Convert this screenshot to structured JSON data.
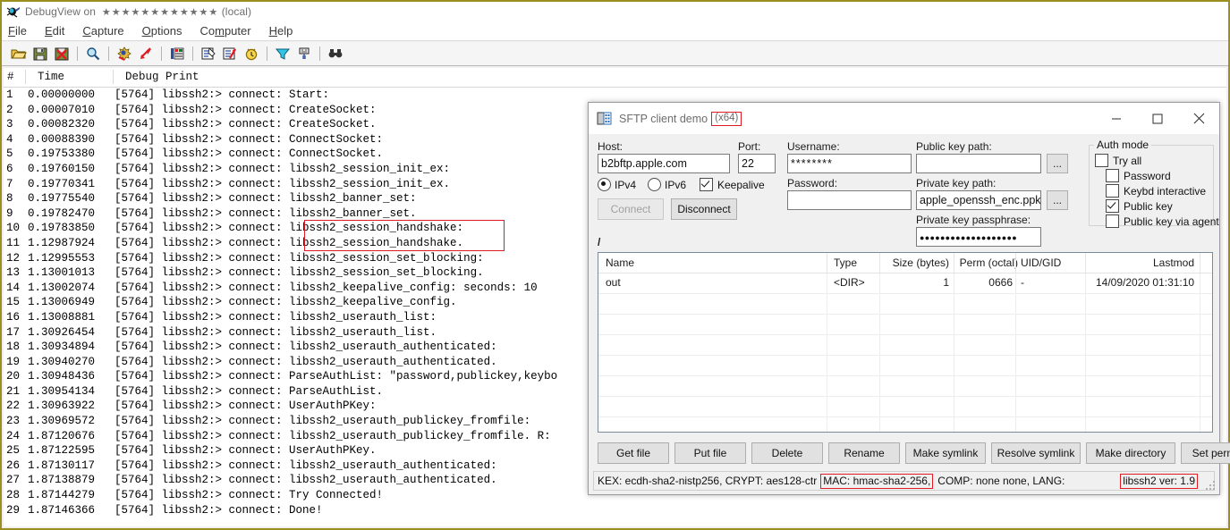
{
  "debugview": {
    "title_prefix": "DebugView on",
    "title_masked": "★★★★★★★★★★★★",
    "title_suffix": "(local)",
    "icon": "bug-icon",
    "menu": [
      {
        "name": "file",
        "pre": "",
        "accel": "F",
        "post": "ile"
      },
      {
        "name": "edit",
        "pre": "",
        "accel": "E",
        "post": "dit"
      },
      {
        "name": "capture",
        "pre": "",
        "accel": "C",
        "post": "apture"
      },
      {
        "name": "options",
        "pre": "",
        "accel": "O",
        "post": "ptions"
      },
      {
        "name": "computer",
        "pre": "Co",
        "accel": "m",
        "post": "puter"
      },
      {
        "name": "help",
        "pre": "",
        "accel": "H",
        "post": "elp"
      }
    ],
    "toolbar": [
      {
        "name": "open-icon",
        "kind": "icon"
      },
      {
        "name": "save-icon",
        "kind": "icon"
      },
      {
        "name": "clear-icon",
        "kind": "icon"
      },
      {
        "name": "separator",
        "kind": "sep"
      },
      {
        "name": "find-icon",
        "kind": "icon"
      },
      {
        "name": "separator",
        "kind": "sep"
      },
      {
        "name": "capture-win32-icon",
        "kind": "icon"
      },
      {
        "name": "capture-kernel-icon",
        "kind": "icon"
      },
      {
        "name": "separator",
        "kind": "sep"
      },
      {
        "name": "capture-events-icon",
        "kind": "icon"
      },
      {
        "name": "separator",
        "kind": "sep"
      },
      {
        "name": "autoscroll-icon",
        "kind": "icon"
      },
      {
        "name": "clear-display-icon",
        "kind": "icon"
      },
      {
        "name": "clock-icon",
        "kind": "icon"
      },
      {
        "name": "separator",
        "kind": "sep"
      },
      {
        "name": "filter-icon",
        "kind": "icon"
      },
      {
        "name": "highlight-icon",
        "kind": "icon"
      },
      {
        "name": "separator",
        "kind": "sep"
      },
      {
        "name": "find-next-icon",
        "kind": "icon"
      }
    ],
    "columns": [
      "#",
      "Time",
      "Debug Print"
    ],
    "rows": [
      {
        "n": "1",
        "t": "0.00000000",
        "m": "[5764] libssh2:> connect: Start:"
      },
      {
        "n": "2",
        "t": "0.00007010",
        "m": "[5764] libssh2:> connect: CreateSocket:"
      },
      {
        "n": "3",
        "t": "0.00082320",
        "m": "[5764] libssh2:> connect: CreateSocket."
      },
      {
        "n": "4",
        "t": "0.00088390",
        "m": "[5764] libssh2:> connect: ConnectSocket:"
      },
      {
        "n": "5",
        "t": "0.19753380",
        "m": "[5764] libssh2:> connect: ConnectSocket."
      },
      {
        "n": "6",
        "t": "0.19760150",
        "m": "[5764] libssh2:> connect: libssh2_session_init_ex:"
      },
      {
        "n": "7",
        "t": "0.19770341",
        "m": "[5764] libssh2:> connect: libssh2_session_init_ex."
      },
      {
        "n": "8",
        "t": "0.19775540",
        "m": "[5764] libssh2:> connect: libssh2_banner_set:"
      },
      {
        "n": "9",
        "t": "0.19782470",
        "m": "[5764] libssh2:> connect: libssh2_banner_set."
      },
      {
        "n": "10",
        "t": "0.19783850",
        "m": "[5764] libssh2:> connect: libssh2_session_handshake:"
      },
      {
        "n": "11",
        "t": "1.12987924",
        "m": "[5764] libssh2:> connect: libssh2_session_handshake."
      },
      {
        "n": "12",
        "t": "1.12995553",
        "m": "[5764] libssh2:> connect: libssh2_session_set_blocking:"
      },
      {
        "n": "13",
        "t": "1.13001013",
        "m": "[5764] libssh2:> connect: libssh2_session_set_blocking."
      },
      {
        "n": "14",
        "t": "1.13002074",
        "m": "[5764] libssh2:> connect: libssh2_keepalive_config: seconds: 10"
      },
      {
        "n": "15",
        "t": "1.13006949",
        "m": "[5764] libssh2:> connect: libssh2_keepalive_config."
      },
      {
        "n": "16",
        "t": "1.13008881",
        "m": "[5764] libssh2:> connect: libssh2_userauth_list:"
      },
      {
        "n": "17",
        "t": "1.30926454",
        "m": "[5764] libssh2:> connect: libssh2_userauth_list."
      },
      {
        "n": "18",
        "t": "1.30934894",
        "m": "[5764] libssh2:> connect: libssh2_userauth_authenticated:"
      },
      {
        "n": "19",
        "t": "1.30940270",
        "m": "[5764] libssh2:> connect: libssh2_userauth_authenticated."
      },
      {
        "n": "20",
        "t": "1.30948436",
        "m": "[5764] libssh2:> connect: ParseAuthList: \"password,publickey,keybo"
      },
      {
        "n": "21",
        "t": "1.30954134",
        "m": "[5764] libssh2:> connect: ParseAuthList."
      },
      {
        "n": "22",
        "t": "1.30963922",
        "m": "[5764] libssh2:> connect: UserAuthPKey:"
      },
      {
        "n": "23",
        "t": "1.30969572",
        "m": "[5764] libssh2:> connect: libssh2_userauth_publickey_fromfile:"
      },
      {
        "n": "24",
        "t": "1.87120676",
        "m": "[5764] libssh2:> connect: libssh2_userauth_publickey_fromfile. R:"
      },
      {
        "n": "25",
        "t": "1.87122595",
        "m": "[5764] libssh2:> connect: UserAuthPKey."
      },
      {
        "n": "26",
        "t": "1.87130117",
        "m": "[5764] libssh2:> connect: libssh2_userauth_authenticated:"
      },
      {
        "n": "27",
        "t": "1.87138879",
        "m": "[5764] libssh2:> connect: libssh2_userauth_authenticated."
      },
      {
        "n": "28",
        "t": "1.87144279",
        "m": "[5764] libssh2:> connect: Try Connected!"
      },
      {
        "n": "29",
        "t": "1.87146366",
        "m": "[5764] libssh2:> connect: Done!"
      }
    ]
  },
  "sftp": {
    "title": "SFTP client demo",
    "arch": "(x64)",
    "window_buttons": {
      "minimize": "─",
      "maximize": "☐",
      "close": "✕"
    },
    "labels": {
      "host": "Host:",
      "port": "Port:",
      "username": "Username:",
      "password": "Password:",
      "public_key_path": "Public key path:",
      "private_key_path": "Private key path:",
      "private_key_passphrase": "Private key passphrase:",
      "auth_mode": "Auth mode",
      "browse": "..."
    },
    "values": {
      "host": "b2bftp.apple.com",
      "port": "22",
      "username": "********",
      "password": "",
      "public_key_path": "",
      "private_key_path": "apple_openssh_enc.ppk",
      "private_key_passphrase": "●●●●●●●●●●●●●●●●●●●"
    },
    "ip_mode": {
      "ipv4": "IPv4",
      "ipv6": "IPv6",
      "selected": "IPv4"
    },
    "keepalive": {
      "label": "Keepalive",
      "checked": true
    },
    "connect_button": "Connect",
    "disconnect_button": "Disconnect",
    "auth_modes": [
      {
        "label": "Try all",
        "checked": false,
        "indent": 0
      },
      {
        "label": "Password",
        "checked": false,
        "indent": 1
      },
      {
        "label": "Keybd interactive",
        "checked": false,
        "indent": 1
      },
      {
        "label": "Public key",
        "checked": true,
        "indent": 1
      },
      {
        "label": "Public key via agent",
        "checked": false,
        "indent": 1
      }
    ],
    "path": "/",
    "file_columns": [
      "Name",
      "Type",
      "Size (bytes)",
      "Perm (octal)",
      "UID/GID",
      "Lastmod"
    ],
    "files": [
      {
        "name": "out",
        "type": "<DIR>",
        "size": "1",
        "perm": "0666",
        "uidgid": "-",
        "lastmod": "14/09/2020 01:31:10"
      }
    ],
    "action_buttons": [
      "Get file",
      "Put file",
      "Delete",
      "Rename",
      "Make symlink",
      "Resolve symlink",
      "Make directory",
      "Set perms"
    ],
    "status": {
      "kex": "KEX: ecdh-sha2-nistp256, CRYPT: aes128-ctr",
      "mac": "MAC: hmac-sha2-256,",
      "comp": "COMP: none none, LANG:",
      "version": "libssh2 ver: 1.9"
    }
  },
  "accent": {
    "highlight_red": "#e01b24",
    "titlebar_border": "#9a8f1f"
  }
}
